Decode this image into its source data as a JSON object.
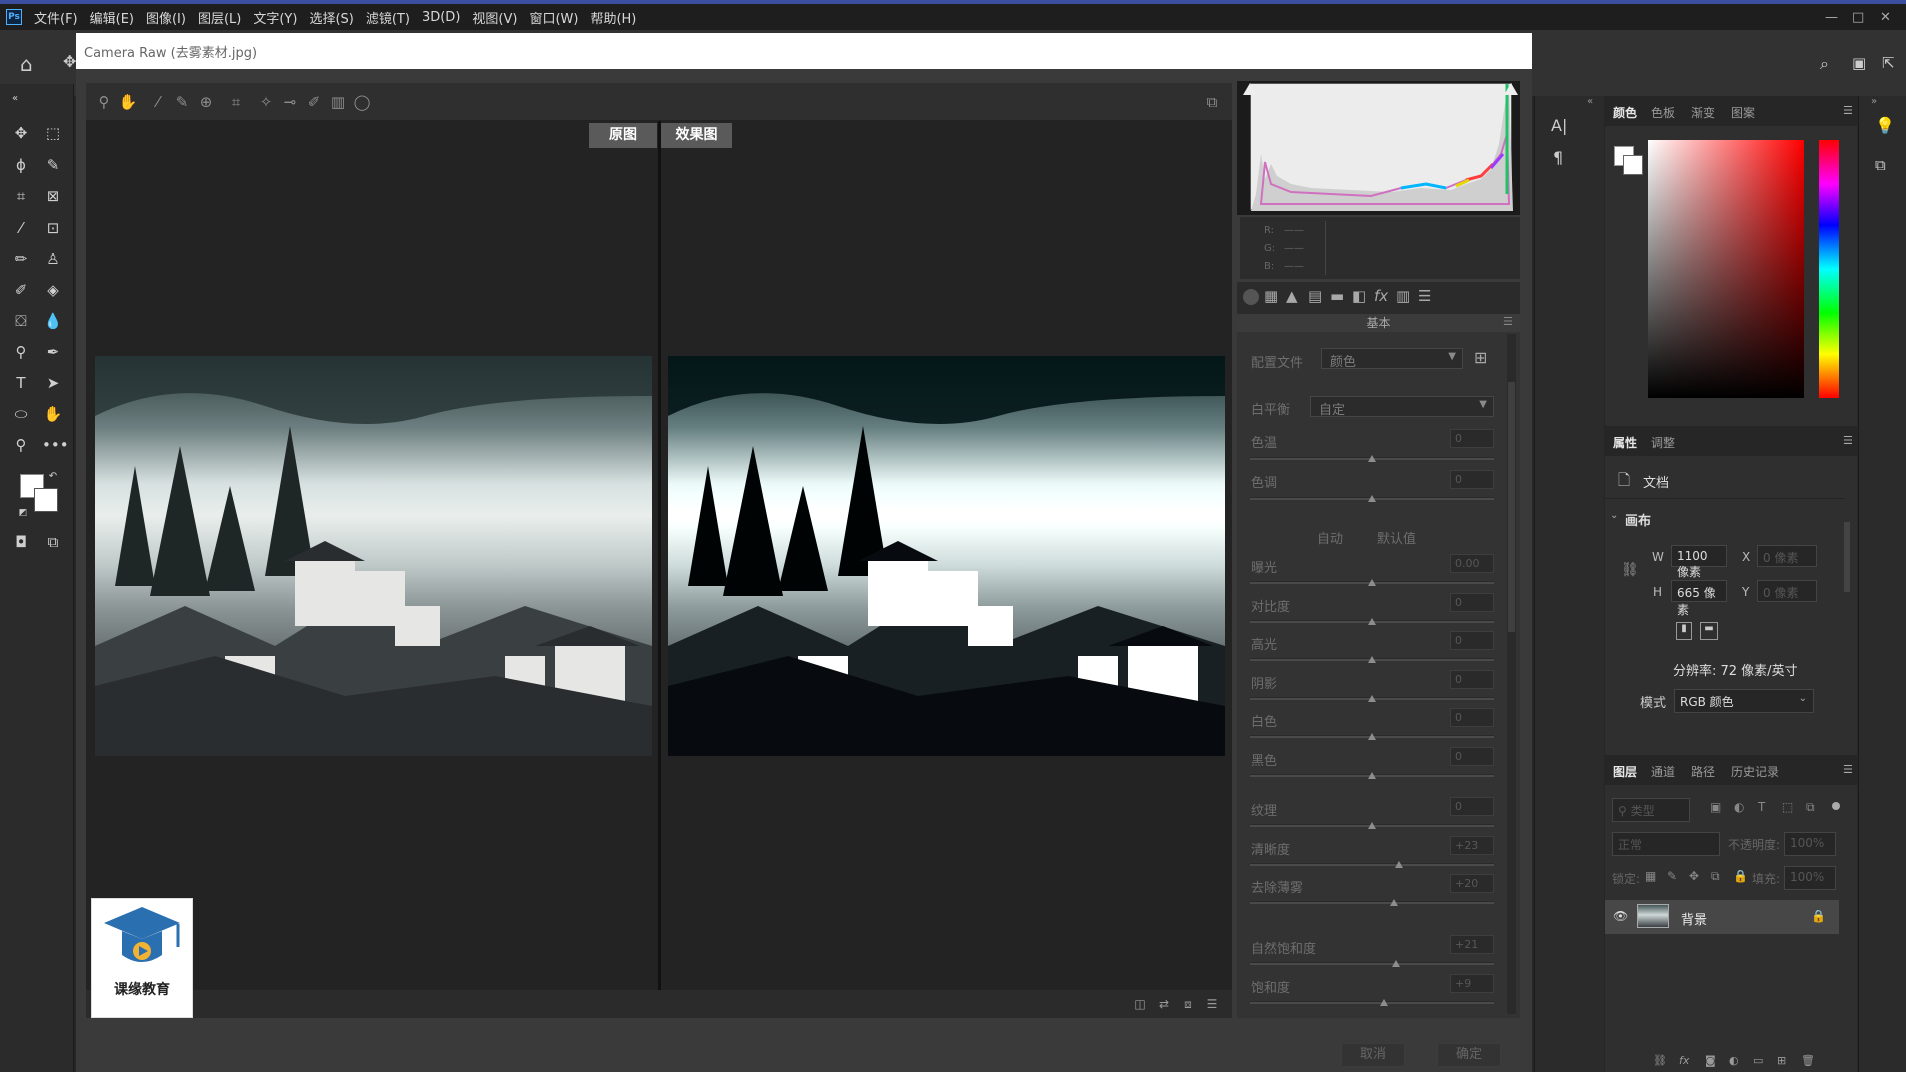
{
  "menubar": {
    "app_icon": "Ps",
    "items": [
      "文件(F)",
      "编辑(E)",
      "图像(I)",
      "图层(L)",
      "文字(Y)",
      "选择(S)",
      "滤镜(T)",
      "3D(D)",
      "视图(V)",
      "窗口(W)",
      "帮助(H)"
    ]
  },
  "dialog": {
    "title": "Camera Raw (去雾素材.jpg)",
    "preview_tabs": {
      "before": "原图",
      "after": "效果图"
    },
    "panel_title": "基本",
    "profile": {
      "label": "配置文件",
      "value": "颜色"
    },
    "white_balance": {
      "label": "白平衡",
      "value": "自定"
    },
    "temperature": {
      "label": "色温",
      "value": "0"
    },
    "tint": {
      "label": "色调",
      "value": "0"
    },
    "auto_label": "自动",
    "default_label": "默认值",
    "sliders": [
      {
        "key": "exposure",
        "label": "曝光",
        "value": "0.00",
        "pos": 0.5
      },
      {
        "key": "contrast",
        "label": "对比度",
        "value": "0",
        "pos": 0.5
      },
      {
        "key": "highlights",
        "label": "高光",
        "value": "0",
        "pos": 0.5
      },
      {
        "key": "shadows",
        "label": "阴影",
        "value": "0",
        "pos": 0.5
      },
      {
        "key": "whites",
        "label": "白色",
        "value": "0",
        "pos": 0.5
      },
      {
        "key": "blacks",
        "label": "黑色",
        "value": "0",
        "pos": 0.5
      }
    ],
    "sliders2": [
      {
        "key": "texture",
        "label": "纹理",
        "value": "0",
        "pos": 0.5
      },
      {
        "key": "clarity",
        "label": "清晰度",
        "value": "+23",
        "pos": 0.61
      },
      {
        "key": "dehaze",
        "label": "去除薄雾",
        "value": "+20",
        "pos": 0.59
      }
    ],
    "sliders3": [
      {
        "key": "vibrance",
        "label": "自然饱和度",
        "value": "+21",
        "pos": 0.6
      },
      {
        "key": "saturation",
        "label": "饱和度",
        "value": "+9",
        "pos": 0.55
      }
    ],
    "rgb_readout": {
      "r": "R:",
      "g": "G:",
      "b": "B:",
      "dash": "——"
    },
    "cancel_label": "取消",
    "ok_label": "确定",
    "logo_text": "课缘教育"
  },
  "right": {
    "color_tabs": [
      "颜色",
      "色板",
      "渐变",
      "图案"
    ],
    "props_tabs": [
      "属性",
      "调整"
    ],
    "doc_label": "文档",
    "canvas_label": "画布",
    "w_label": "W",
    "w_value": "1100 像素",
    "h_label": "H",
    "h_value": "665 像素",
    "x_label": "X",
    "x_value": "0 像素",
    "y_label": "Y",
    "y_value": "0 像素",
    "resolution": "分辨率: 72 像素/英寸",
    "mode_label": "模式",
    "mode_value": "RGB 颜色",
    "layers_tabs": [
      "图层",
      "通道",
      "路径",
      "历史记录"
    ],
    "layer_kind": "类型",
    "blend_mode": "正常",
    "opacity_label": "不透明度:",
    "opacity_value": "100%",
    "lock_label": "锁定:",
    "fill_label": "填充:",
    "fill_value": "100%",
    "layer_name": "背景"
  },
  "colors": {
    "accent": "#3b4ea0",
    "dialog_bg": "#3a3a3a",
    "panel_bg": "#333333"
  }
}
